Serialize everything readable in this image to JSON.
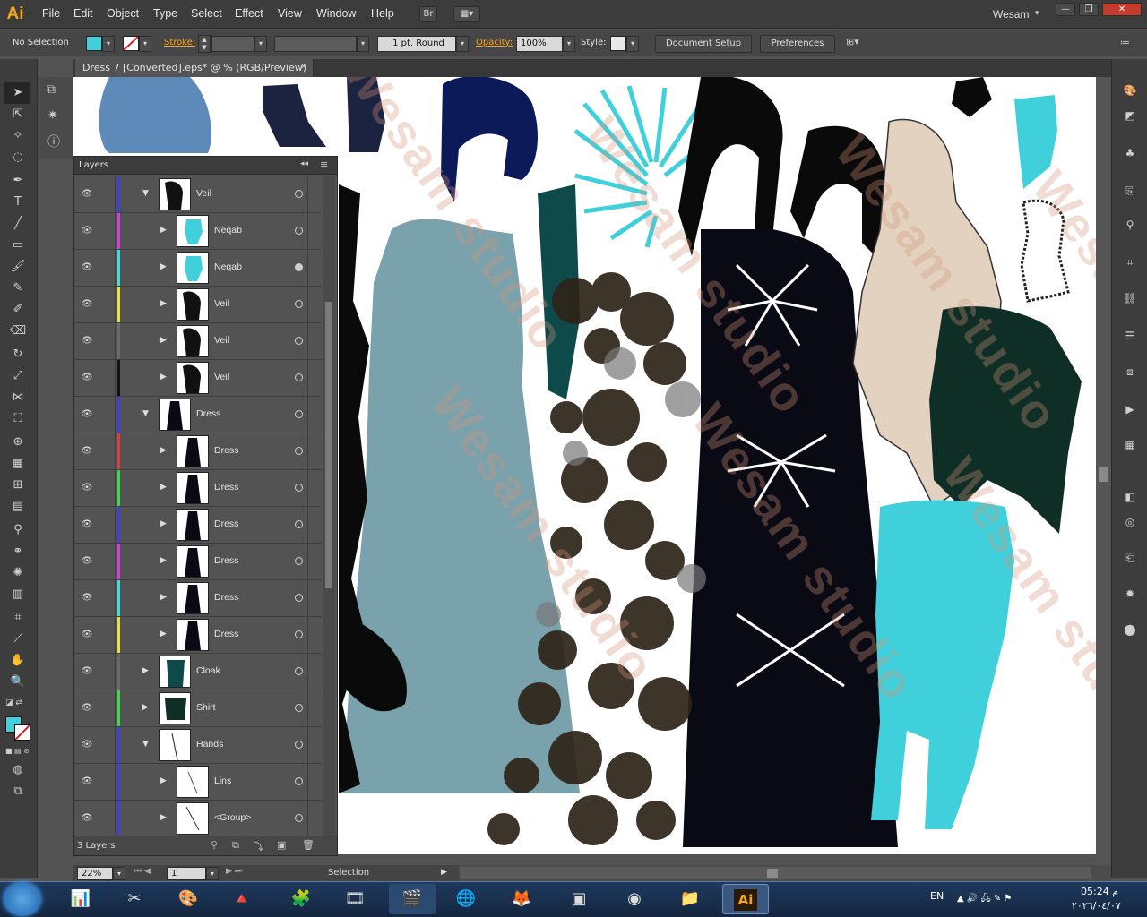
{
  "app": {
    "logo": "Ai",
    "user": "Wesam",
    "user_chevron": "▾"
  },
  "menu": [
    "File",
    "Edit",
    "Object",
    "Type",
    "Select",
    "Effect",
    "View",
    "Window",
    "Help"
  ],
  "menubar_buttons": {
    "bridge": "Br",
    "arrange": "▦▾"
  },
  "window_controls": {
    "minimize": "—",
    "restore": "❐",
    "close": "✕"
  },
  "control_bar": {
    "selection": "No Selection",
    "fill_color": "#3fd0dc",
    "stroke_label": "Stroke:",
    "stroke_value": "",
    "brush": "1 pt. Round",
    "opacity_label": "Opacity:",
    "opacity_value": "100%",
    "style_label": "Style:",
    "document_setup": "Document Setup",
    "preferences": "Preferences"
  },
  "document_tab": {
    "title": "Dress 7 [Converted].eps* @ % (RGB/Preview)",
    "close": "✕"
  },
  "layers_panel": {
    "title": "Layers",
    "collapse": "◂◂",
    "menu": "≡",
    "footer_count": "3 Layers",
    "rows": [
      {
        "name": "Veil",
        "expanded": true,
        "color": "#4040d8",
        "target_filled": false
      },
      {
        "name": "Neqab",
        "expanded": false,
        "color": "#d23fd8",
        "target_filled": false
      },
      {
        "name": "Neqab",
        "expanded": false,
        "color": "#3fdcdc",
        "target_filled": true
      },
      {
        "name": "Veil",
        "expanded": false,
        "color": "#e8e040",
        "target_filled": false
      },
      {
        "name": "Veil",
        "expanded": false,
        "color": "#6a6a6a",
        "target_filled": false
      },
      {
        "name": "Veil",
        "expanded": false,
        "color": "#111111",
        "target_filled": false
      },
      {
        "name": "Dress",
        "expanded": true,
        "color": "#4040d8",
        "target_filled": false
      },
      {
        "name": "Dress",
        "expanded": false,
        "color": "#d84040",
        "target_filled": false
      },
      {
        "name": "Dress",
        "expanded": false,
        "color": "#3fd84a",
        "target_filled": false
      },
      {
        "name": "Dress",
        "expanded": false,
        "color": "#4040d8",
        "target_filled": false
      },
      {
        "name": "Dress",
        "expanded": false,
        "color": "#d23fd8",
        "target_filled": false
      },
      {
        "name": "Dress",
        "expanded": false,
        "color": "#3fdcdc",
        "target_filled": false
      },
      {
        "name": "Dress",
        "expanded": false,
        "color": "#e8e040",
        "target_filled": false
      },
      {
        "name": "Cloak",
        "expanded": false,
        "color": "#6a6a6a",
        "target_filled": false
      },
      {
        "name": "Shirt",
        "expanded": false,
        "color": "#3fd84a",
        "target_filled": false
      },
      {
        "name": "Hands",
        "expanded": true,
        "color": "#4040d8",
        "target_filled": false
      },
      {
        "name": "Lins",
        "expanded": false,
        "color": "#4040d8",
        "target_filled": false
      },
      {
        "name": "<Group>",
        "expanded": false,
        "color": "#4040d8",
        "target_filled": false
      }
    ]
  },
  "status": {
    "zoom": "22%",
    "artboard": "1",
    "mode": "Selection"
  },
  "watermark": "Wesam studio",
  "taskbar": {
    "language": "EN",
    "time": "05:24 م",
    "date": "٢٠٢٦/٠٤/٠٧"
  }
}
